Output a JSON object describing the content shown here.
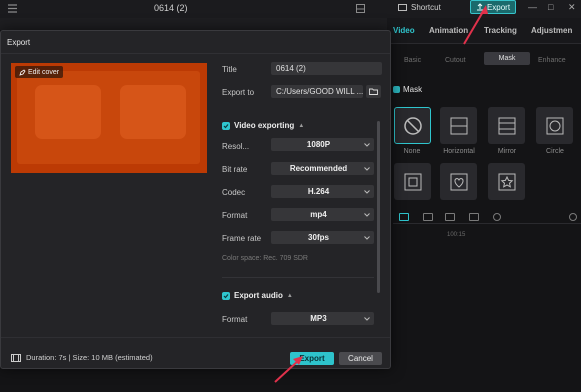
{
  "topbar": {
    "project_title": "0614 (2)",
    "shortcut_label": "Shortcut",
    "export_label": "Export"
  },
  "panel": {
    "tabs": [
      {
        "label": "Video",
        "active": true
      },
      {
        "label": "Animation",
        "active": false
      },
      {
        "label": "Tracking",
        "active": false
      },
      {
        "label": "Adjustmen",
        "active": false
      }
    ],
    "subtabs": [
      {
        "label": "Basic"
      },
      {
        "label": "Cutout"
      },
      {
        "label": "Mask"
      },
      {
        "label": "Enhance"
      }
    ],
    "mask_heading": "Mask",
    "masks": [
      {
        "label": "None",
        "icon": "none-icon"
      },
      {
        "label": "Horizontal",
        "icon": "horizontal-mask-icon"
      },
      {
        "label": "Mirror",
        "icon": "mirror-mask-icon"
      },
      {
        "label": "Circle",
        "icon": "circle-mask-icon"
      },
      {
        "label": "",
        "icon": "rectangle-mask-icon"
      },
      {
        "label": "",
        "icon": "heart-mask-icon"
      },
      {
        "label": "",
        "icon": "star-mask-icon"
      }
    ],
    "time_label": "100:15"
  },
  "dialog": {
    "title": "Export",
    "edit_cover_label": "Edit cover",
    "title_label": "Title",
    "title_value": "0614 (2)",
    "export_to_label": "Export to",
    "export_to_value": "C:/Users/GOOD WILL ...",
    "video_section": "Video exporting",
    "resolution_label": "Resol...",
    "resolution_value": "1080P",
    "bitrate_label": "Bit rate",
    "bitrate_value": "Recommended",
    "codec_label": "Codec",
    "codec_value": "H.264",
    "format_label": "Format",
    "format_value": "mp4",
    "framerate_label": "Frame rate",
    "framerate_value": "30fps",
    "color_space": "Color space: Rec. 709 SDR",
    "audio_section": "Export audio",
    "audio_format_label": "Format",
    "audio_format_value": "MP3",
    "footer_info": "Duration: 7s | Size: 10 MB (estimated)",
    "export_button": "Export",
    "cancel_button": "Cancel"
  },
  "colors": {
    "accent": "#2fc6ce",
    "cover": "#c8470c",
    "arrow": "#e0314b"
  }
}
